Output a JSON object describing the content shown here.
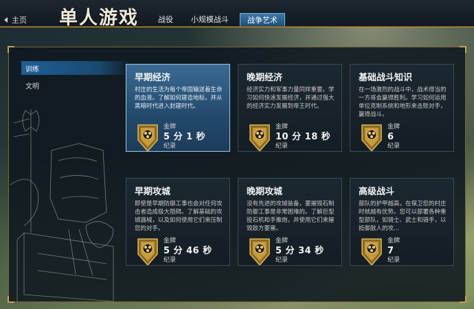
{
  "topbar": {
    "home_label": "主页",
    "title": "单人游戏",
    "tabs": [
      {
        "label": "战役",
        "active": false
      },
      {
        "label": "小规模战斗",
        "active": false
      },
      {
        "label": "战争艺术",
        "active": true
      }
    ]
  },
  "sidebar": {
    "items": [
      {
        "label": "训练",
        "active": true
      },
      {
        "label": "文明",
        "active": false
      }
    ]
  },
  "cards": [
    {
      "title": "早期经济",
      "description": "村庄的生活为每个帝国输送着生命的血液。了解如何建造地标，并从黑暗时代进入封建时代。",
      "medal_label": "金牌",
      "time": "5 分 1 秒",
      "record_label": "纪录",
      "selected": true
    },
    {
      "title": "晚期经济",
      "description": "经济实力和军事力量同样重要。学习如何快速发展经济，并通过强大的经济实力发展到帝王时代。",
      "medal_label": "金牌",
      "time": "10 分 18 秒",
      "record_label": "纪录",
      "selected": false
    },
    {
      "title": "基础战斗知识",
      "description": "在一场激烈的战斗中，战术得当的一方将会赢得胜利。学习如何运用单位克制系统和地形来击败对手，赢得战斗。",
      "medal_label": "金牌",
      "time": "6",
      "record_label": "纪录",
      "selected": false
    },
    {
      "title": "早期攻城",
      "description": "即使是早期防御工事也会对任何攻击者造成极大阻碍。了解基础的攻城器械，以及如何使用它们来压制您的对手。",
      "medal_label": "金牌",
      "time": "5 分 46 秒",
      "record_label": "纪录",
      "selected": false
    },
    {
      "title": "晚期攻城",
      "description": "没有先进的攻城装备，要摧毁石制防御工事是非常困难的。了解巨型投石机和手推炮，并使用它们来摧毁敌方要塞。",
      "medal_label": "金牌",
      "time": "5 分 34 秒",
      "record_label": "纪录",
      "selected": false
    },
    {
      "title": "高级战斗",
      "description": "部队的护甲越高，在保卫您的村庄时就越有优势。您可以部署各种重型部队，如骑士、武士和骑手，以抵御敌人的攻...",
      "medal_label": "金牌",
      "time": "7",
      "record_label": "纪录",
      "selected": false
    }
  ],
  "icons": {
    "home": "chevron-left-icon",
    "medal": "gold-medal-icon"
  },
  "colors": {
    "accent_gold": "#b88d3c",
    "selected_blue": "#3a6a93",
    "tab_active": "#2f6a98"
  }
}
